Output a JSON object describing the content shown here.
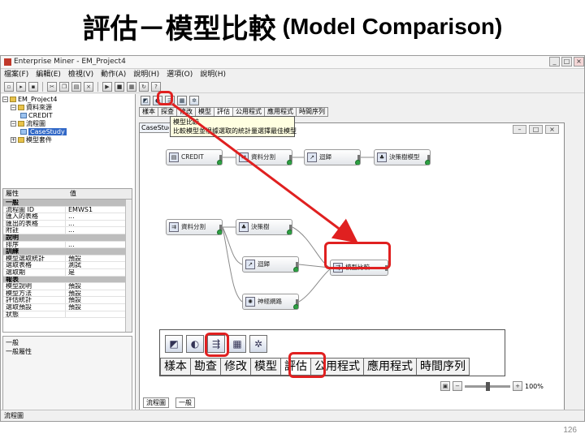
{
  "slide": {
    "title_zh": "評估－模型比較",
    "title_en": "(Model Comparison)",
    "page_number": "126"
  },
  "window": {
    "title": "Enterprise Miner - EM_Project4",
    "buttons": [
      "_",
      "□",
      "×"
    ]
  },
  "menu": [
    "檔案(F)",
    "編輯(E)",
    "檢視(V)",
    "動作(A)",
    "說明(H)",
    "選項(O)",
    "說明(H)"
  ],
  "tree": [
    {
      "label": "EM_Project4",
      "type": "root"
    },
    {
      "label": "資料來源",
      "type": "folder"
    },
    {
      "label": "CREDIT",
      "type": "item"
    },
    {
      "label": "流程圖",
      "type": "folder"
    },
    {
      "label": "CaseStudy",
      "type": "item",
      "selected": true
    },
    {
      "label": "模型套件",
      "type": "folder"
    }
  ],
  "properties": {
    "header_key": "屬性",
    "header_value": "值",
    "rows": [
      {
        "key": "一般",
        "value": "",
        "group": true
      },
      {
        "key": "流程圖 ID",
        "value": "EMWS1",
        "group": false
      },
      {
        "key": "匯入的表格",
        "value": "...",
        "group": false
      },
      {
        "key": "匯出的表格",
        "value": "...",
        "group": false
      },
      {
        "key": "附註",
        "value": "...",
        "group": false
      },
      {
        "key": "說明",
        "value": "",
        "group": true
      },
      {
        "key": "排序",
        "value": "...",
        "group": false
      },
      {
        "key": "訓練",
        "value": "",
        "group": true
      },
      {
        "key": "模型選取統計",
        "value": "預設",
        "group": false
      },
      {
        "key": "選取表格",
        "value": "測試",
        "group": false
      },
      {
        "key": "選取期",
        "value": "是",
        "group": false
      },
      {
        "key": "報表",
        "value": "",
        "group": true
      },
      {
        "key": "模型說明",
        "value": "預設",
        "group": false
      },
      {
        "key": "模型方法",
        "value": "預設",
        "group": false
      },
      {
        "key": "評估統計",
        "value": "預設",
        "group": false
      },
      {
        "key": "選取預設",
        "value": "預設",
        "group": false
      },
      {
        "key": "狀態",
        "value": "",
        "group": false
      }
    ]
  },
  "description": {
    "line1": "一般",
    "line2": "一般屬性"
  },
  "tabs": [
    "樣本",
    "探查",
    "修改",
    "模型",
    "評估",
    "公用程式",
    "應用程式",
    "時間序列"
  ],
  "tooltip": {
    "title": "模型比較",
    "body": "比較模型並根據選取的統計量選擇最佳模型"
  },
  "diagram": {
    "tab_label": "CaseStudy",
    "nodes": [
      {
        "id": "credit",
        "label": "CREDIT",
        "icon": "table-icon"
      },
      {
        "id": "data-partition-top",
        "label": "資料分割",
        "icon": "partition-icon"
      },
      {
        "id": "regression",
        "label": "迴歸",
        "icon": "regression-icon"
      },
      {
        "id": "tree-top",
        "label": "決策樹模型",
        "icon": "tree-icon"
      },
      {
        "id": "partition",
        "label": "資料分割",
        "icon": "partition-icon"
      },
      {
        "id": "decision-tree",
        "label": "決策樹",
        "icon": "tree-icon"
      },
      {
        "id": "regression2",
        "label": "迴歸",
        "icon": "regression-icon"
      },
      {
        "id": "neural",
        "label": "神經網路",
        "icon": "neural-icon"
      },
      {
        "id": "model-compare",
        "label": "模型比較",
        "icon": "compare-icon"
      }
    ]
  },
  "zoom_panel": {
    "tabs": [
      "樣本",
      "勘查",
      "修改",
      "模型",
      "評估",
      "公用程式",
      "應用程式",
      "時間序列"
    ],
    "active_tab": "評估",
    "icons": [
      "cutoff-icon",
      "decisions-icon",
      "model-compare-icon",
      "score-icon",
      "segment-profile-icon"
    ]
  },
  "status": {
    "left": "流程圖",
    "zoom": "100%",
    "combo1": "流程圖",
    "combo2": "一般"
  },
  "colors": {
    "highlight": "#e02020",
    "arrow": "#e02020",
    "selected": "#3168c7",
    "success": "#2ea043"
  }
}
